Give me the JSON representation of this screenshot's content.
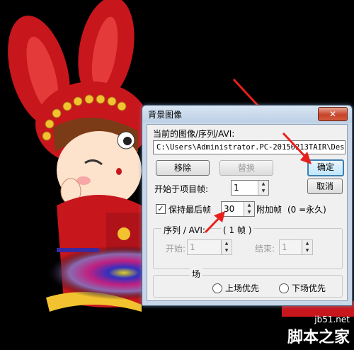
{
  "dialog": {
    "title": "背景图像",
    "close_label": "✕",
    "current_label": "当前的图像/序列/AVI:",
    "path_value": "C:\\Users\\Administrator.PC-20150213TAIR\\Desk",
    "remove_label": "移除",
    "replace_label": "替换",
    "ok_label": "确定",
    "cancel_label": "取消",
    "start_frame_label": "开始于项目帧:",
    "start_frame_value": "1",
    "hold_last_label": "保持最后帧",
    "hold_value": "30",
    "extra_frames_label": "附加帧",
    "extra_frames_hint": "(0 =永久)",
    "sequence_label": "序列 / AVI:",
    "sequence_frames": "( 1 帧 )",
    "begin_label": "开始:",
    "begin_value": "1",
    "end_label": "结束:",
    "end_value": "1",
    "field_group_label": "场",
    "upper_first_label": "上场优先",
    "lower_first_label": "下场优先"
  },
  "watermark": {
    "site": "jb51.net",
    "name": "脚本之家"
  }
}
